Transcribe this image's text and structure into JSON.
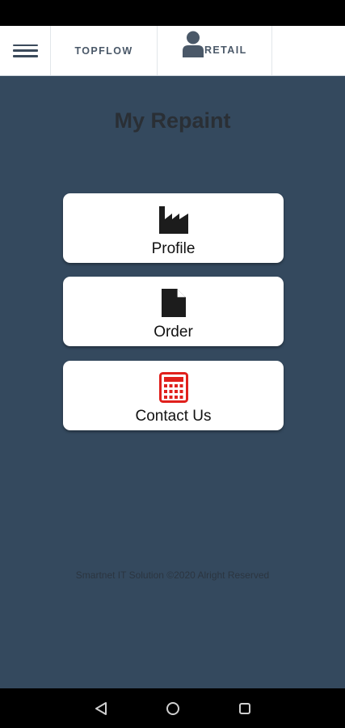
{
  "header": {
    "menu_icon": "hamburger-menu-icon",
    "tabs": [
      {
        "label": "TOPFLOW"
      },
      {
        "label": "RETAIL",
        "icon": "user-icon"
      }
    ]
  },
  "main": {
    "title": "My Repaint",
    "cards": [
      {
        "label": "Profile",
        "icon": "factory-icon"
      },
      {
        "label": "Order",
        "icon": "document-icon"
      },
      {
        "label": "Contact Us",
        "icon": "calculator-icon"
      }
    ],
    "footer": "Smartnet IT Solution ©2020 Alright Reserved"
  },
  "system_nav": {
    "buttons": [
      "back-icon",
      "home-icon",
      "recents-icon"
    ]
  },
  "colors": {
    "background": "#34495e",
    "calculator_icon": "#e0201c",
    "header_bg": "#ffffff"
  }
}
